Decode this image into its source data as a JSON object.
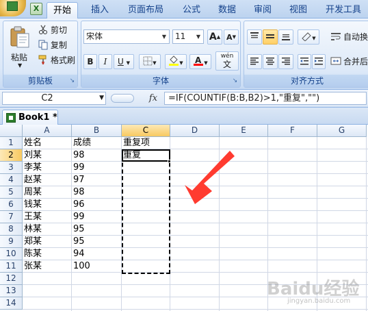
{
  "tabs": [
    {
      "label": "开始",
      "active": true
    },
    {
      "label": "插入",
      "active": false
    },
    {
      "label": "页面布局",
      "active": false
    },
    {
      "label": "公式",
      "active": false
    },
    {
      "label": "数据",
      "active": false
    },
    {
      "label": "审阅",
      "active": false
    },
    {
      "label": "视图",
      "active": false
    },
    {
      "label": "开发工具",
      "active": false
    }
  ],
  "clipboard": {
    "paste_label": "粘贴",
    "cut_label": "剪切",
    "copy_label": "复制",
    "format_painter_label": "格式刷",
    "group_label": "剪贴板"
  },
  "font": {
    "font_name": "宋体",
    "font_size": "11",
    "grow_label": "A",
    "shrink_label": "A",
    "bold_label": "B",
    "italic_label": "I",
    "underline_label": "U",
    "phonetic_label": "wén",
    "group_label": "字体",
    "fill_color": "#ffff00",
    "font_color": "#ff0000"
  },
  "alignment": {
    "wrap_label": "自动换",
    "merge_label": "合并后",
    "group_label": "对齐方式"
  },
  "formula_bar": {
    "name_box": "C2",
    "fx_label": "fx",
    "formula": "=IF(COUNTIF(B:B,B2)>1,\"重复\",\"\")"
  },
  "workbook": {
    "tab_label": "Book1 *"
  },
  "grid": {
    "columns": [
      "A",
      "B",
      "C",
      "D",
      "E",
      "F",
      "G"
    ],
    "rows": [
      "1",
      "2",
      "3",
      "4",
      "5",
      "6",
      "7",
      "8",
      "9",
      "10",
      "11",
      "12",
      "13",
      "14"
    ],
    "cells": {
      "A1": "姓名",
      "B1": "成绩",
      "C1": "重复项",
      "A2": "刘某",
      "B2": "98",
      "C2": "重复",
      "A3": "李某",
      "B3": "99",
      "A4": "赵某",
      "B4": "97",
      "A5": "周某",
      "B5": "98",
      "A6": "钱某",
      "B6": "96",
      "A7": "王某",
      "B7": "99",
      "A8": "林某",
      "B8": "95",
      "A9": "郑某",
      "B9": "95",
      "A10": "陈某",
      "B10": "94",
      "A11": "张某",
      "B11": "100"
    }
  },
  "annotation": {
    "arrow_color": "#ff3b30"
  },
  "watermark": {
    "text": "Baidu经验",
    "sub": "jingyan.baidu.com"
  }
}
